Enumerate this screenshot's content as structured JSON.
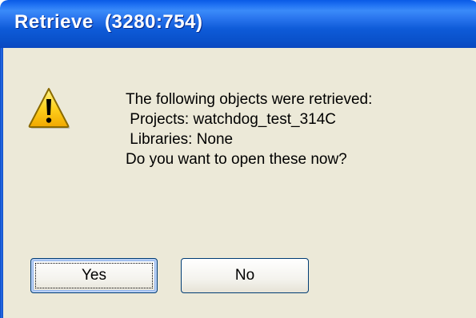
{
  "window": {
    "title": "Retrieve  (3280:754)"
  },
  "message": {
    "lines": [
      "The following objects were retrieved:",
      " Projects: watchdog_test_314C",
      " Libraries: None",
      "Do you want to open these now?"
    ]
  },
  "buttons": {
    "yes_label": "Yes",
    "no_label": "No"
  },
  "icons": {
    "warning": "warning-icon"
  },
  "colors": {
    "titlebar": "#0a52cc",
    "dialog_background": "#ece9d8",
    "title_text": "#ffffff",
    "warning_yellow": "#ffd21e"
  }
}
